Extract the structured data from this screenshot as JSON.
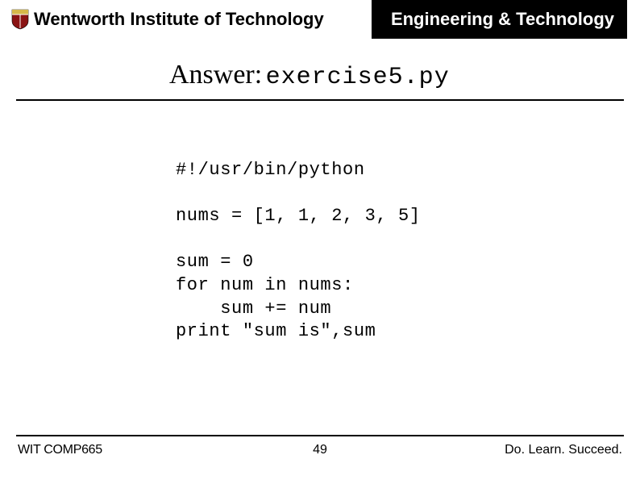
{
  "header": {
    "institution": "Wentworth Institute of Technology",
    "department": "Engineering & Technology"
  },
  "title": {
    "label": "Answer:",
    "filename": "exercise5.py"
  },
  "code": "#!/usr/bin/python\n\nnums = [1, 1, 2, 3, 5]\n\nsum = 0\nfor num in nums:\n    sum += num\nprint \"sum is\",sum",
  "footer": {
    "course": "WIT COMP665",
    "page": "49",
    "tagline": "Do. Learn. Succeed."
  }
}
